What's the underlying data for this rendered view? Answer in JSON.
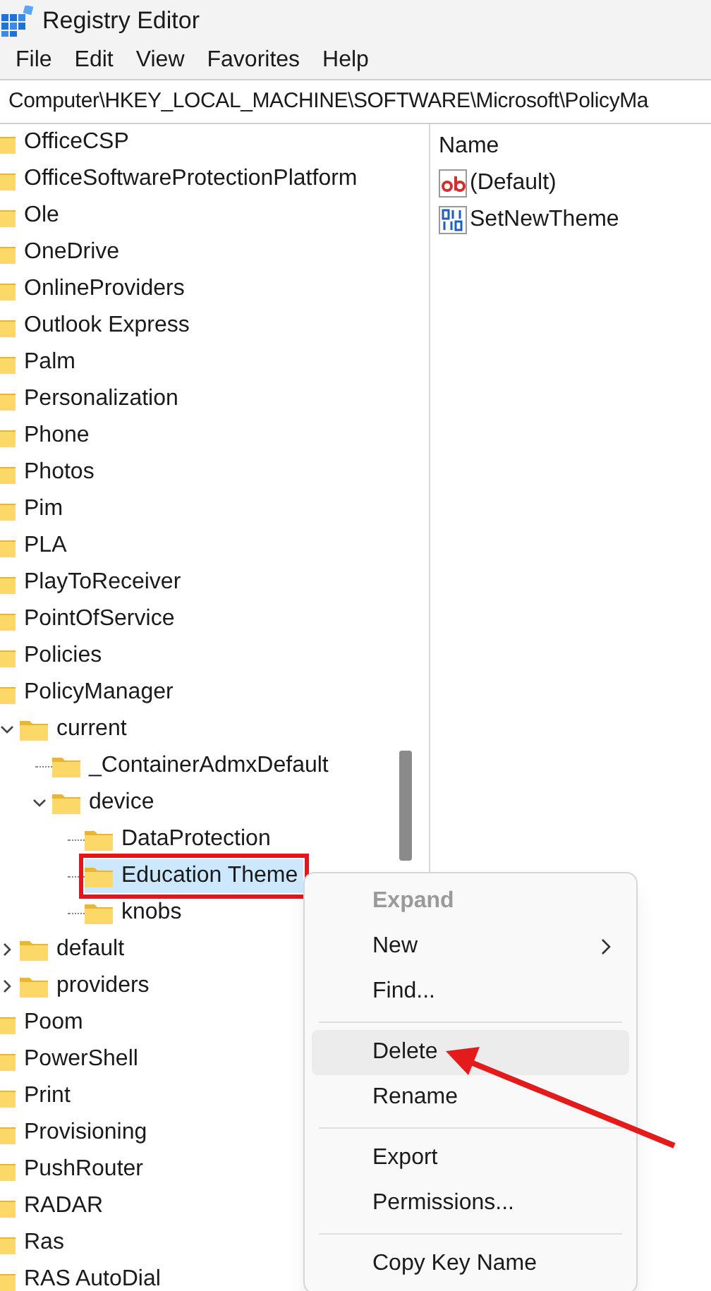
{
  "window": {
    "title": "Registry Editor"
  },
  "menu_bar": [
    "File",
    "Edit",
    "View",
    "Favorites",
    "Help"
  ],
  "address_bar": "Computer\\HKEY_LOCAL_MACHINE\\SOFTWARE\\Microsoft\\PolicyMa",
  "tree": [
    {
      "label": "OfficeCSP",
      "selected": false
    },
    {
      "label": "OfficeSoftwareProtectionPlatform",
      "selected": false
    },
    {
      "label": "Ole",
      "selected": false
    },
    {
      "label": "OneDrive",
      "selected": false
    },
    {
      "label": "OnlineProviders",
      "selected": false
    },
    {
      "label": "Outlook Express",
      "selected": false
    },
    {
      "label": "Palm",
      "selected": false
    },
    {
      "label": "Personalization",
      "selected": false
    },
    {
      "label": "Phone",
      "selected": false
    },
    {
      "label": "Photos",
      "selected": false
    },
    {
      "label": "Pim",
      "selected": false
    },
    {
      "label": "PLA",
      "selected": false
    },
    {
      "label": "PlayToReceiver",
      "selected": false
    },
    {
      "label": "PointOfService",
      "selected": false
    },
    {
      "label": "Policies",
      "selected": false
    },
    {
      "label": "PolicyManager",
      "selected": false,
      "children": [
        {
          "label": "current",
          "selected": false,
          "expanded": true,
          "children": [
            {
              "label": "_ContainerAdmxDefault",
              "selected": false
            },
            {
              "label": "device",
              "selected": false,
              "expanded": true,
              "children": [
                {
                  "label": "DataProtection",
                  "selected": false
                },
                {
                  "label": "Education Theme",
                  "selected": true,
                  "highlighted": true
                },
                {
                  "label": "knobs",
                  "selected": false
                }
              ]
            }
          ]
        },
        {
          "label": "default",
          "selected": false,
          "expanded": false
        },
        {
          "label": "providers",
          "selected": false,
          "expanded": false
        }
      ]
    },
    {
      "label": "Poom",
      "selected": false
    },
    {
      "label": "PowerShell",
      "selected": false
    },
    {
      "label": "Print",
      "selected": false
    },
    {
      "label": "Provisioning",
      "selected": false
    },
    {
      "label": "PushRouter",
      "selected": false
    },
    {
      "label": "RADAR",
      "selected": false
    },
    {
      "label": "Ras",
      "selected": false
    },
    {
      "label": "RAS AutoDial",
      "selected": false
    }
  ],
  "values_pane": {
    "columns": [
      "Name"
    ],
    "rows": [
      {
        "name": "(Default)",
        "kind": "string"
      },
      {
        "name": "SetNewTheme",
        "kind": "binary"
      }
    ]
  },
  "context_menu": [
    {
      "kind": "item",
      "label": "Expand",
      "disabled": true,
      "highlighted": false
    },
    {
      "kind": "item",
      "label": "New",
      "disabled": false,
      "highlighted": false,
      "submenu": true
    },
    {
      "kind": "item",
      "label": "Find...",
      "disabled": false,
      "highlighted": false
    },
    {
      "kind": "separator"
    },
    {
      "kind": "item",
      "label": "Delete",
      "disabled": false,
      "highlighted": true
    },
    {
      "kind": "item",
      "label": "Rename",
      "disabled": false,
      "highlighted": false
    },
    {
      "kind": "separator"
    },
    {
      "kind": "item",
      "label": "Export",
      "disabled": false,
      "highlighted": false
    },
    {
      "kind": "item",
      "label": "Permissions...",
      "disabled": false,
      "highlighted": false
    },
    {
      "kind": "separator"
    },
    {
      "kind": "item",
      "label": "Copy Key Name",
      "disabled": false,
      "highlighted": false
    }
  ]
}
